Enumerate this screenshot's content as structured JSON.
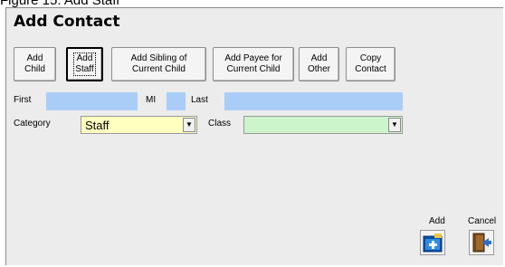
{
  "caption": "Figure 15: Add Staff",
  "dialog": {
    "title": "Add Contact",
    "buttons": [
      {
        "id": "add-child",
        "label": "Add\nChild"
      },
      {
        "id": "add-staff",
        "label": "Add\nStaff"
      },
      {
        "id": "add-sibling",
        "label": "Add Sibling of\nCurrent Child"
      },
      {
        "id": "add-payee",
        "label": "Add Payee for\nCurrent Child"
      },
      {
        "id": "add-other",
        "label": "Add\nOther"
      },
      {
        "id": "copy-contact",
        "label": "Copy\nContact"
      }
    ],
    "fields": {
      "first_label": "First",
      "mi_label": "MI",
      "last_label": "Last",
      "category_label": "Category",
      "category_value": "Staff",
      "class_label": "Class",
      "class_value": ""
    },
    "actions": {
      "add_label": "Add",
      "cancel_label": "Cancel"
    },
    "colors": {
      "name_fields": "#a9cdf7",
      "category_field": "#ffffc0",
      "class_field": "#ccf5cc"
    }
  }
}
